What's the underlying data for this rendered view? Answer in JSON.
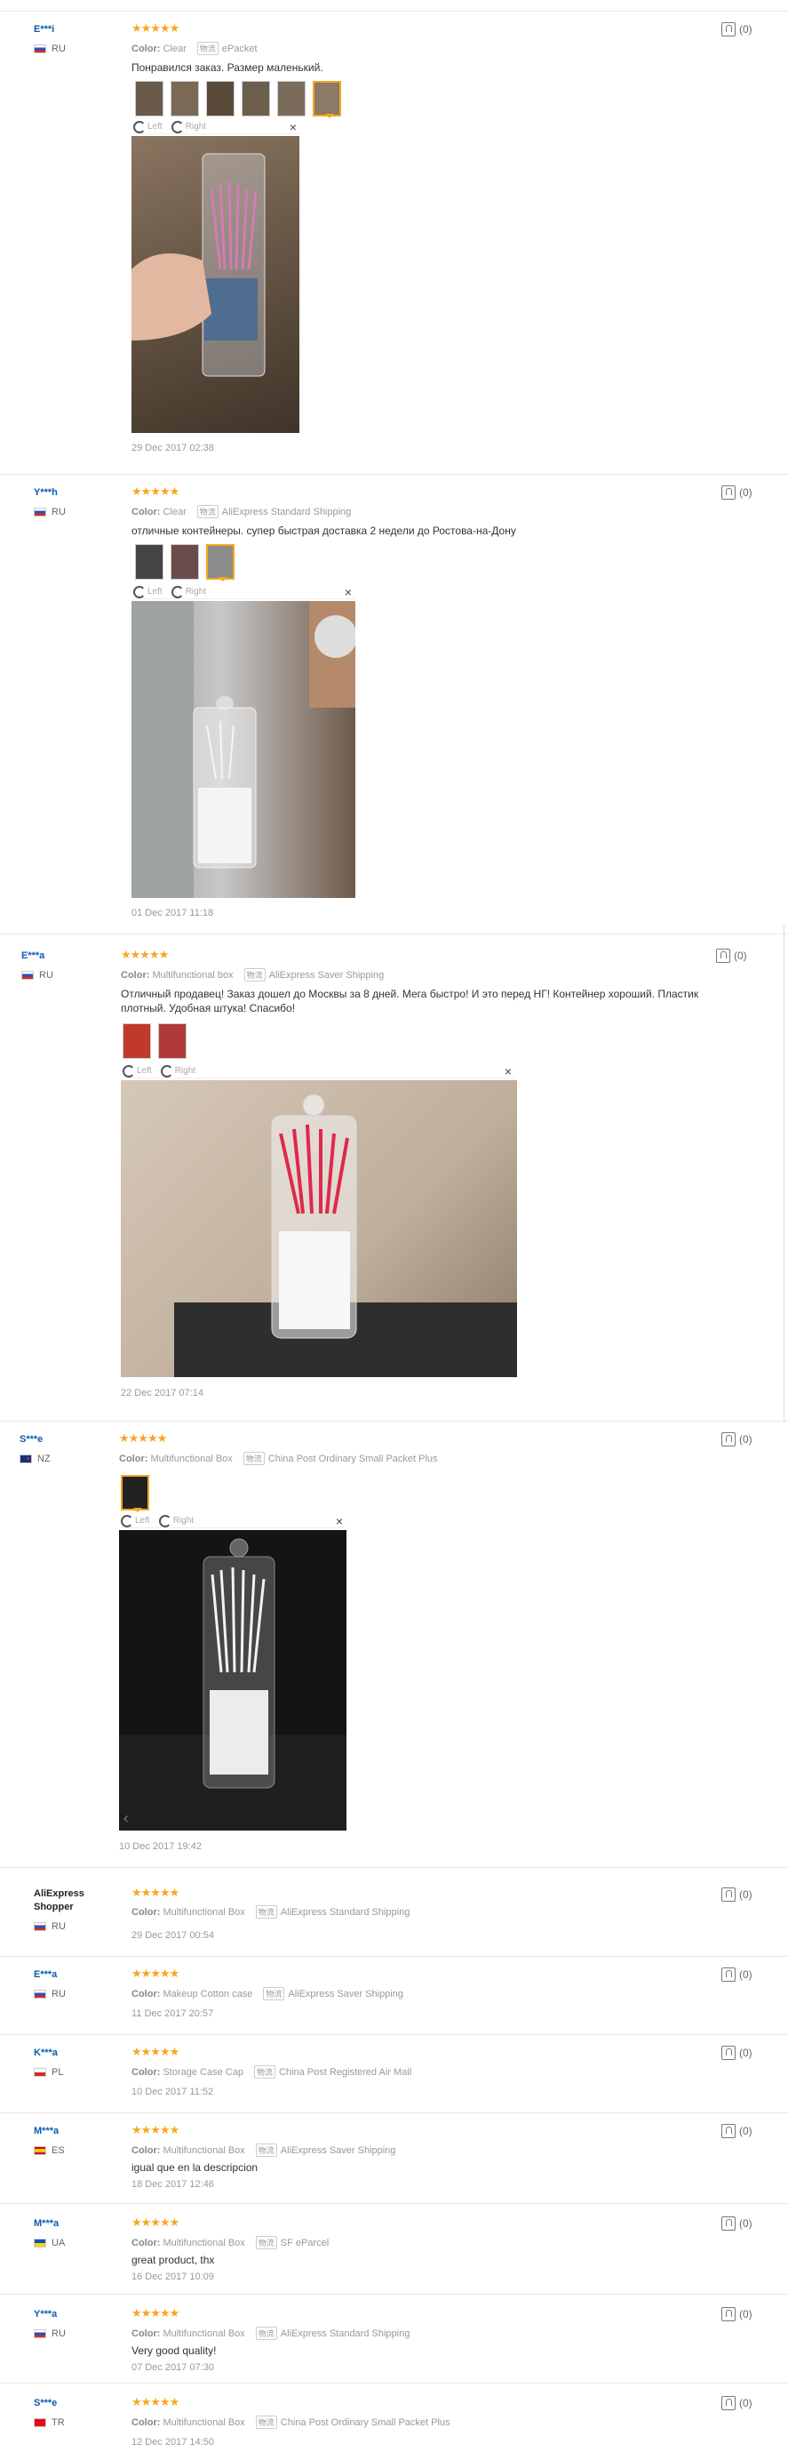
{
  "reviews": [
    {
      "name": "E***i",
      "country": "RU",
      "flag": "ru",
      "color_label": "Color:",
      "color": "Clear",
      "shipping": "ePacket",
      "text": "Понравился заказ. Размер маленький.",
      "date": "29 Dec 2017 02:38",
      "likes": "(0)",
      "thumb_count": 6,
      "rotate_left": "Left",
      "rotate_right": "Right",
      "close": "×",
      "photo_desc": "hand holding container with pink swabs"
    },
    {
      "name": "Y***h",
      "country": "RU",
      "flag": "ru",
      "color_label": "Color:",
      "color": "Clear",
      "shipping": "AliExpress Standard Shipping",
      "text": "отличные контейнеры. супер быстрая доставка 2 недели до Ростова-на-Дону",
      "date": "01 Dec 2017 11:18",
      "likes": "(0)",
      "thumb_count": 3,
      "rotate_left": "Left",
      "rotate_right": "Right",
      "close": "×"
    },
    {
      "name": "E***a",
      "country": "RU",
      "flag": "ru",
      "color_label": "Color:",
      "color": "Multifunctional box",
      "shipping": "AliExpress Saver Shipping",
      "text_lines": [
        "Отличный продавец! Заказ дошел до Москвы за 8 дней. Мега быстро! И это перед НГ! Контейнер хороший. Пластик",
        "плотный. Удобная штука! Спасибо!"
      ],
      "date": "22 Dec 2017 07:14",
      "likes": "(0)",
      "thumb_count": 2,
      "rotate_left": "Left",
      "rotate_right": "Right",
      "close": "×"
    },
    {
      "name": "S***e",
      "country": "NZ",
      "flag": "nz",
      "color_label": "Color:",
      "color": "Multifunctional Box",
      "shipping": "China Post Ordinary Small Packet Plus",
      "date": "10 Dec 2017 19:42",
      "likes": "(0)",
      "thumb_count": 1,
      "rotate_left": "Left",
      "rotate_right": "Right",
      "close": "×"
    },
    {
      "name_lines": [
        "AliExpress",
        "Shopper"
      ],
      "country": "RU",
      "flag": "ru",
      "color_label": "Color:",
      "color": "Multifunctional Box",
      "shipping": "AliExpress Standard Shipping",
      "date": "29 Dec 2017 00:54",
      "likes": "(0)"
    },
    {
      "name": "E***a",
      "country": "RU",
      "flag": "ru",
      "color_label": "Color:",
      "color": "Makeup Cotton case",
      "shipping": "AliExpress Saver Shipping",
      "date": "11 Dec 2017 20:57",
      "likes": "(0)"
    },
    {
      "name": "K***a",
      "country": "PL",
      "flag": "pl",
      "color_label": "Color:",
      "color": "Storage Case Cap",
      "shipping": "China Post Registered Air Mail",
      "date": "10 Dec 2017 11:52",
      "likes": "(0)"
    },
    {
      "name": "M***a",
      "country": "ES",
      "flag": "es",
      "color_label": "Color:",
      "color": "Multifunctional Box",
      "shipping": "AliExpress Saver Shipping",
      "text": "igual que en la descripcion",
      "date": "18 Dec 2017 12:46",
      "likes": "(0)"
    },
    {
      "name": "M***a",
      "country": "UA",
      "flag": "ua",
      "color_label": "Color:",
      "color": "Multifunctional Box",
      "shipping": "SF eParcel",
      "text": "great product, thx",
      "date": "16 Dec 2017 10:09",
      "likes": "(0)"
    },
    {
      "name": "Y***a",
      "country": "RU",
      "flag": "ru",
      "color_label": "Color:",
      "color": "Multifunctional Box",
      "shipping": "AliExpress Standard Shipping",
      "text": "Very good quality!",
      "date": "07 Dec 2017 07:30",
      "likes": "(0)"
    },
    {
      "name": "S***e",
      "country": "TR",
      "flag": "tr",
      "color_label": "Color:",
      "color": "Multifunctional Box",
      "shipping": "China Post Ordinary Small Packet Plus",
      "date": "12 Dec 2017 14:50",
      "likes": "(0)"
    }
  ],
  "stars": "★★★★★",
  "ship_icon": "物流",
  "colors": {
    "star": "#f5a623",
    "name": "#0b5bb0",
    "thumb_border": "#f5a623"
  }
}
